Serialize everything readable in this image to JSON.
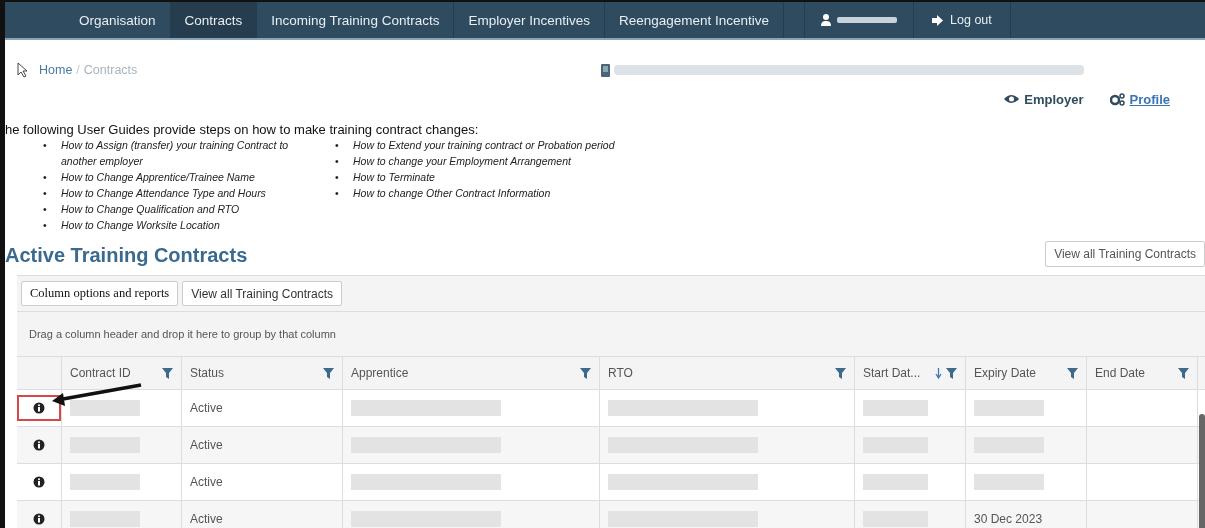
{
  "nav": {
    "items": [
      {
        "label": "Organisation",
        "selected": false
      },
      {
        "label": "Contracts",
        "selected": true
      },
      {
        "label": "Incoming Training Contracts",
        "selected": false
      },
      {
        "label": "Employer Incentives",
        "selected": false
      },
      {
        "label": "Reengagement Incentive",
        "selected": false
      }
    ],
    "logout": "Log out"
  },
  "breadcrumb": [
    {
      "label": "Home",
      "current": false
    },
    {
      "label": "Contracts",
      "current": true
    }
  ],
  "breadcrumb_separator": "/",
  "header_links": {
    "employer": "Employer",
    "profile": "Profile"
  },
  "guides": {
    "bullet": "•",
    "intro": "he following User Guides provide steps on how to make training contract changes:",
    "columns": [
      [
        "How to Assign (transfer) your training Contract to another employer",
        "How to Change Apprentice/Trainee Name",
        "How to Change Attendance Type and Hours",
        "How to Change Qualification and RTO",
        "How to Change Worksite Location"
      ],
      [
        "How to Extend your training contract or Probation period",
        "How to change your Employment Arrangement",
        "How to Terminate",
        "How to change Other Contract Information"
      ]
    ]
  },
  "section_title": "Active Training Contracts",
  "view_all_button": "View all Training Contracts",
  "grid": {
    "toolbar": [
      "Column options and reports",
      "View all Training Contracts"
    ],
    "group_hint": "Drag a column header and drop it here to group by that column",
    "columns": [
      {
        "label": "Contract ID",
        "sorted": false
      },
      {
        "label": "Status",
        "sorted": false
      },
      {
        "label": "Apprentice",
        "sorted": false
      },
      {
        "label": "RTO",
        "sorted": false
      },
      {
        "label": "Start Dat...",
        "sorted": true
      },
      {
        "label": "Expiry Date",
        "sorted": false
      },
      {
        "label": "End Date",
        "sorted": false
      }
    ],
    "rows": [
      {
        "highlighted": true,
        "cells": [
          {
            "redacted": true
          },
          {
            "text": "Active"
          },
          {
            "redacted": true
          },
          {
            "redacted": true
          },
          {
            "redacted": true
          },
          {
            "redacted": true
          }
        ]
      },
      {
        "highlighted": false,
        "cells": [
          {
            "redacted": true
          },
          {
            "text": "Active"
          },
          {
            "redacted": true
          },
          {
            "redacted": true
          },
          {
            "redacted": true
          },
          {
            "redacted": true
          }
        ]
      },
      {
        "highlighted": false,
        "cells": [
          {
            "redacted": true
          },
          {
            "text": "Active"
          },
          {
            "redacted": true
          },
          {
            "redacted": true
          },
          {
            "redacted": true
          },
          {
            "redacted": true
          }
        ]
      },
      {
        "highlighted": false,
        "cells": [
          {
            "redacted": true
          },
          {
            "text": "Active"
          },
          {
            "redacted": true
          },
          {
            "redacted": true
          },
          {
            "redacted": true
          },
          {
            "text": "30 Dec 2023"
          }
        ]
      }
    ]
  }
}
